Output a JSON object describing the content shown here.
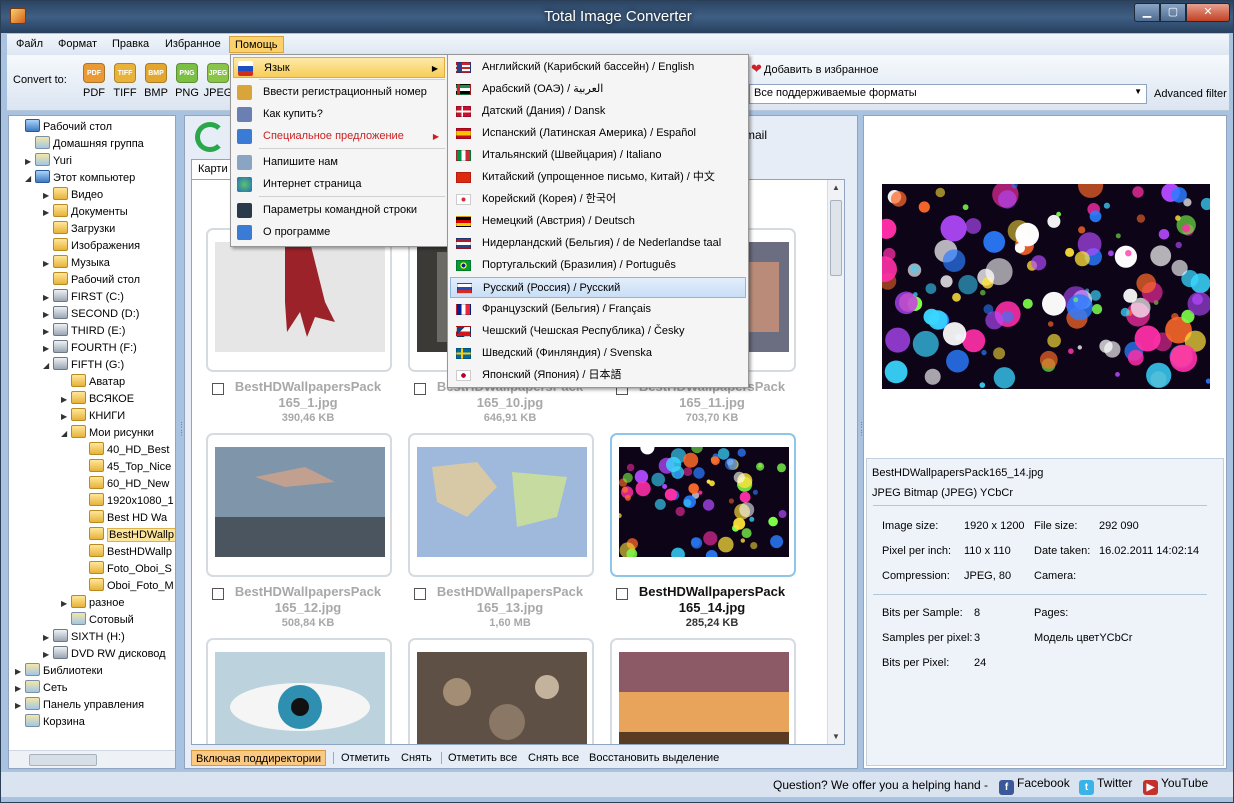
{
  "window": {
    "title": "Total Image Converter",
    "min": "▁",
    "max": "▢",
    "close": "✕"
  },
  "menubar": [
    "Файл",
    "Формат",
    "Правка",
    "Избранное",
    "Помощь"
  ],
  "toolbar": {
    "convert_label": "Convert to:",
    "formats": [
      {
        "label": "PDF",
        "color": "#e99a35"
      },
      {
        "label": "TIFF",
        "color": "#e9b23a"
      },
      {
        "label": "BMP",
        "color": "#e3a72f"
      },
      {
        "label": "PNG",
        "color": "#7bc043"
      },
      {
        "label": "JPEG",
        "color": "#8bc44a"
      }
    ],
    "favorites": "Добавить в избранное",
    "filter_value": "Все поддерживаемые форматы",
    "advanced_filter": "Advanced filter"
  },
  "tree": [
    {
      "label": "Рабочий стол",
      "icon": "desktop-icon",
      "twisty": ""
    },
    {
      "label": "Домашняя группа",
      "icon": "homegroup-icon",
      "twisty": ""
    },
    {
      "label": "Yuri",
      "icon": "user-icon",
      "twisty": "▶"
    },
    {
      "label": "Этот компьютер",
      "icon": "computer-icon",
      "twisty": "◢"
    },
    {
      "label": "Видео",
      "icon": "folder-icon",
      "twisty": "▶"
    },
    {
      "label": "Документы",
      "icon": "folder-icon",
      "twisty": "▶"
    },
    {
      "label": "Загрузки",
      "icon": "folder-icon",
      "twisty": ""
    },
    {
      "label": "Изображения",
      "icon": "folder-icon",
      "twisty": ""
    },
    {
      "label": "Музыка",
      "icon": "folder-icon",
      "twisty": "▶"
    },
    {
      "label": "Рабочий стол",
      "icon": "folder-icon",
      "twisty": ""
    },
    {
      "label": "FIRST (C:)",
      "icon": "drive-icon",
      "twisty": "▶"
    },
    {
      "label": "SECOND (D:)",
      "icon": "drive-icon",
      "twisty": "▶"
    },
    {
      "label": "THIRD (E:)",
      "icon": "drive-icon",
      "twisty": "▶"
    },
    {
      "label": "FOURTH (F:)",
      "icon": "drive-icon",
      "twisty": "▶"
    },
    {
      "label": "FIFTH (G:)",
      "icon": "drive-icon",
      "twisty": "◢"
    },
    {
      "label": "Аватар",
      "icon": "folder-icon",
      "twisty": ""
    },
    {
      "label": "ВСЯКОЕ",
      "icon": "folder-icon",
      "twisty": "▶"
    },
    {
      "label": "КНИГИ",
      "icon": "folder-icon",
      "twisty": "▶"
    },
    {
      "label": "Мои рисунки",
      "icon": "folder-icon",
      "twisty": "◢"
    },
    {
      "label": "40_HD_Best",
      "icon": "folder-icon",
      "twisty": ""
    },
    {
      "label": "45_Top_Nice",
      "icon": "folder-icon",
      "twisty": ""
    },
    {
      "label": "60_HD_New",
      "icon": "folder-icon",
      "twisty": ""
    },
    {
      "label": "1920x1080_1",
      "icon": "folder-icon",
      "twisty": ""
    },
    {
      "label": "Best HD Wa",
      "icon": "folder-icon",
      "twisty": ""
    },
    {
      "label": "BestHDWallp",
      "icon": "folder-icon",
      "twisty": "",
      "selected": true
    },
    {
      "label": "BestHDWallp",
      "icon": "folder-icon",
      "twisty": ""
    },
    {
      "label": "Foto_Oboi_S",
      "icon": "folder-icon",
      "twisty": ""
    },
    {
      "label": "Oboi_Foto_M",
      "icon": "folder-icon",
      "twisty": ""
    },
    {
      "label": "разное",
      "icon": "folder-icon",
      "twisty": "▶"
    },
    {
      "label": "Сотовый",
      "icon": "phone-icon",
      "twisty": ""
    },
    {
      "label": "SIXTH (H:)",
      "icon": "drive-icon",
      "twisty": "▶"
    },
    {
      "label": "DVD RW дисковод",
      "icon": "dvd-icon",
      "twisty": "▶"
    },
    {
      "label": "Библиотеки",
      "icon": "library-icon",
      "twisty": "▶"
    },
    {
      "label": "Сеть",
      "icon": "network-icon",
      "twisty": "▶"
    },
    {
      "label": "Панель управления",
      "icon": "control-panel-icon",
      "twisty": "▶"
    },
    {
      "label": "Корзина",
      "icon": "recycle-bin-icon",
      "twisty": ""
    }
  ],
  "center": {
    "tab_label": "Карти",
    "email_label": "mail"
  },
  "thumbnails": [
    {
      "name": "BestHDWallpapersPack 165_1.jpg",
      "size": "390,46 KB",
      "selected": false
    },
    {
      "name": "BestHDWallpapersPack 165_10.jpg",
      "size": "646,91 KB",
      "selected": false
    },
    {
      "name": "BestHDWallpapersPack 165_11.jpg",
      "size": "703,70 KB",
      "selected": false
    },
    {
      "name": "BestHDWallpapersPack 165_12.jpg",
      "size": "508,84 KB",
      "selected": false
    },
    {
      "name": "BestHDWallpapersPack 165_13.jpg",
      "size": "1,60 MB",
      "selected": false
    },
    {
      "name": "BestHDWallpapersPack 165_14.jpg",
      "size": "285,24 KB",
      "selected": true
    },
    {
      "name": "",
      "size": "",
      "selected": false
    },
    {
      "name": "",
      "size": "",
      "selected": false
    },
    {
      "name": "",
      "size": "",
      "selected": false
    }
  ],
  "bottom_actions": [
    "Включая поддиректории",
    "Отметить",
    "Снять",
    "Отметить все",
    "Снять все",
    "Восстановить выделение"
  ],
  "info": {
    "filename": "BestHDWallpapersPack165_14.jpg",
    "format": "JPEG Bitmap (JPEG) YCbCr",
    "image_size_label": "Image size:",
    "image_size": "1920 x 1200",
    "file_size_label": "File size:",
    "file_size": "292 090",
    "ppi_label": "Pixel per inch:",
    "ppi": "110 x 110",
    "date_label": "Date taken:",
    "date": "16.02.2011 14:02:14",
    "compression_label": "Compression:",
    "compression": "JPEG, 80",
    "camera_label": "Camera:",
    "bps_label": "Bits per Sample:",
    "bps": "8",
    "pages_label": "Pages:",
    "spp_label": "Samples per pixel:",
    "spp": "3",
    "color_model": "Модель цветYCbCr",
    "bpp_label": "Bits per Pixel:",
    "bpp": "24"
  },
  "status": {
    "question": "Question? We offer you a helping hand -",
    "facebook": "Facebook",
    "twitter": "Twitter",
    "youtube": "YouTube"
  },
  "help_menu": [
    {
      "label": "Язык",
      "icon": "russia-flag-icon",
      "arrow": "▶",
      "highlighted": true
    },
    {
      "label": "Ввести регистрационный номер",
      "icon": "key-icon"
    },
    {
      "label": "Как купить?",
      "icon": "card-icon"
    },
    {
      "label": "Специальное предложение",
      "icon": "info-icon",
      "arrow": "▶",
      "red": true
    },
    {
      "label": "Напишите нам",
      "icon": "mail-icon"
    },
    {
      "label": "Интернет страница",
      "icon": "globe-icon"
    },
    {
      "label": "Параметры командной строки",
      "icon": "cmd-icon"
    },
    {
      "label": "О программе",
      "icon": "info-icon"
    }
  ],
  "languages": [
    {
      "label": "Английский (Карибский бассейн) / English",
      "flag": "usa"
    },
    {
      "label": "Арабский (ОАЭ) / العربية",
      "flag": "arab"
    },
    {
      "label": "Датский (Дания) / Dansk",
      "flag": "denmark"
    },
    {
      "label": "Испанский (Латинская Америка) / Español",
      "flag": "spain"
    },
    {
      "label": "Итальянский (Швейцария) / Italiano",
      "flag": "italy"
    },
    {
      "label": "Китайский (упрощенное письмо, Китай) / 中文",
      "flag": "china"
    },
    {
      "label": "Корейский (Корея) / 한국어",
      "flag": "korea"
    },
    {
      "label": "Немецкий (Австрия) / Deutsch",
      "flag": "germany"
    },
    {
      "label": "Нидерландский (Бельгия) / de Nederlandse taal",
      "flag": "netherlands"
    },
    {
      "label": "Португальский (Бразилия) / Português",
      "flag": "brazil"
    },
    {
      "label": "Русский (Россия) / Русский",
      "flag": "russia",
      "highlighted": true
    },
    {
      "label": "Французский (Бельгия) / Français",
      "flag": "france"
    },
    {
      "label": "Чешский (Чешская Республика) / Česky",
      "flag": "czech"
    },
    {
      "label": "Шведский (Финляндия) / Svenska",
      "flag": "sweden"
    },
    {
      "label": "Японский (Япония) / 日本語",
      "flag": "japan"
    }
  ]
}
